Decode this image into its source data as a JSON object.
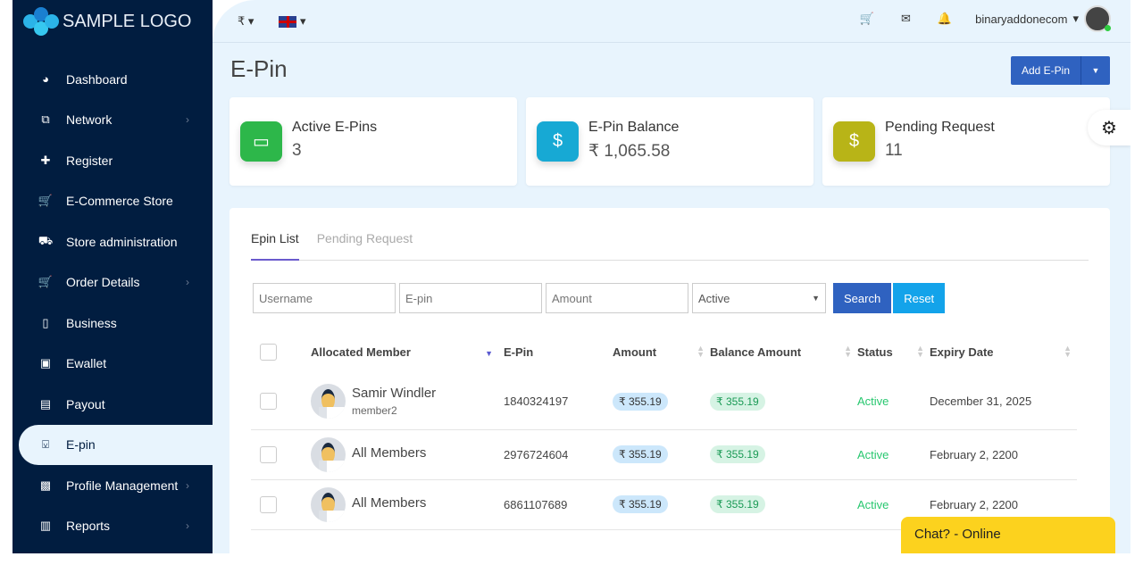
{
  "brand": {
    "logo": "SAMPLE LOGO"
  },
  "sidebar": {
    "items": [
      {
        "label": "Dashboard",
        "icon": "tachometer-icon",
        "glyph": "◕",
        "chevron": false
      },
      {
        "label": "Network",
        "icon": "sitemap-icon",
        "glyph": "⧉",
        "chevron": true
      },
      {
        "label": "Register",
        "icon": "user-plus-icon",
        "glyph": "✚",
        "chevron": false
      },
      {
        "label": "E-Commerce Store",
        "icon": "cart-icon",
        "glyph": "🛒",
        "chevron": false
      },
      {
        "label": "Store administration",
        "icon": "cart-outline-icon",
        "glyph": "⛟",
        "chevron": false
      },
      {
        "label": "Order Details",
        "icon": "cart-icon",
        "glyph": "🛒",
        "chevron": true
      },
      {
        "label": "Business",
        "icon": "tablet-icon",
        "glyph": "▯",
        "chevron": false
      },
      {
        "label": "Ewallet",
        "icon": "briefcase-icon",
        "glyph": "▣",
        "chevron": false
      },
      {
        "label": "Payout",
        "icon": "money-icon",
        "glyph": "▤",
        "chevron": false
      },
      {
        "label": "E-pin",
        "icon": "bookmark-icon",
        "glyph": "⍌",
        "chevron": false,
        "active": true
      },
      {
        "label": "Profile Management",
        "icon": "id-card-icon",
        "glyph": "▩",
        "chevron": true
      },
      {
        "label": "Reports",
        "icon": "bar-chart-icon",
        "glyph": "▥",
        "chevron": true
      }
    ]
  },
  "header": {
    "currency": "₹",
    "username": "binaryaddonecom"
  },
  "page": {
    "title": "E-Pin",
    "add_button": "Add E-Pin"
  },
  "cards": [
    {
      "title": "Active E-Pins",
      "value": "3",
      "color": "#2db74a",
      "glyph": "▭"
    },
    {
      "title": "E-Pin Balance",
      "value": "₹ 1,065.58",
      "color": "#17a9d4",
      "glyph": "$"
    },
    {
      "title": "Pending Request",
      "value": "11",
      "color": "#b8b417",
      "glyph": "$"
    }
  ],
  "tabs": [
    "Epin List",
    "Pending Request"
  ],
  "filters": {
    "username_placeholder": "Username",
    "epin_placeholder": "E-pin",
    "amount_placeholder": "Amount",
    "status_selected": "Active",
    "search": "Search",
    "reset": "Reset"
  },
  "table": {
    "headers": [
      "Allocated Member",
      "E-Pin",
      "Amount",
      "Balance Amount",
      "Status",
      "Expiry Date"
    ],
    "rows": [
      {
        "member": "Samir Windler",
        "sub": "member2",
        "epin": "1840324197",
        "amount": "₹ 355.19",
        "balance": "₹ 355.19",
        "status": "Active",
        "expiry": "December 31, 2025"
      },
      {
        "member": "All Members",
        "sub": "",
        "epin": "2976724604",
        "amount": "₹ 355.19",
        "balance": "₹ 355.19",
        "status": "Active",
        "expiry": "February 2, 2200"
      },
      {
        "member": "All Members",
        "sub": "",
        "epin": "6861107689",
        "amount": "₹ 355.19",
        "balance": "₹ 355.19",
        "status": "Active",
        "expiry": "February 2, 2200"
      }
    ]
  },
  "chat": "Chat? - Online"
}
